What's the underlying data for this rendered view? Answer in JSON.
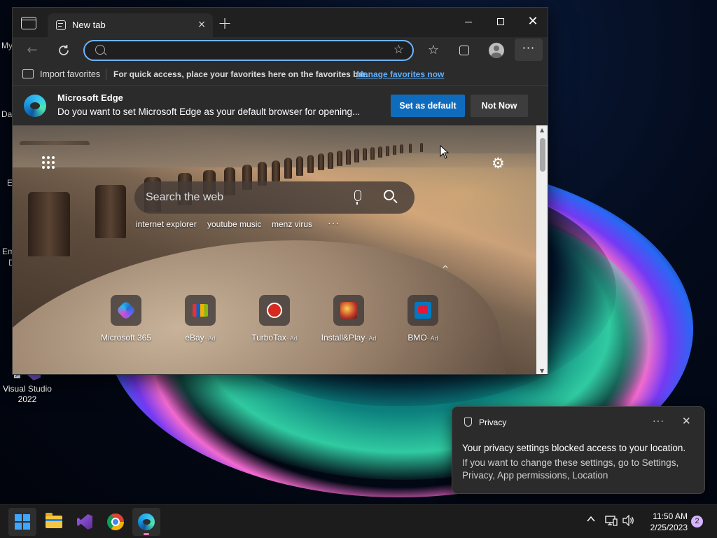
{
  "desktop": {
    "partial_labels": [
      "My",
      "Da",
      "E",
      "Em",
      "D"
    ],
    "visual_studio_label": "Visual Studio 2022"
  },
  "browser": {
    "tab_title": "New tab",
    "tab_close_icon": "×",
    "new_tab_icon": "+",
    "address_placeholder": "",
    "favorites_bar": {
      "import_label": "Import favorites",
      "message": "For quick access, place your favorites here on the favorites bar.",
      "link": "Manage favorites now"
    },
    "infobar": {
      "title": "Microsoft Edge",
      "message": "Do you want to set Microsoft Edge as your default browser for opening...",
      "primary_button": "Set as default",
      "secondary_button": "Not Now"
    },
    "newtab": {
      "search_placeholder": "Search the web",
      "suggestions": [
        "internet explorer",
        "youtube music",
        "menz virus"
      ],
      "more_icon": "···",
      "collapse_icon": "^",
      "quick_links": [
        {
          "label": "Microsoft 365",
          "ad": ""
        },
        {
          "label": "eBay",
          "ad": "· Ad"
        },
        {
          "label": "TurboTax",
          "ad": "· Ad"
        },
        {
          "label": "Install&Play",
          "ad": "· Ad"
        },
        {
          "label": "BMO",
          "ad": "· Ad"
        }
      ]
    }
  },
  "notification": {
    "app": "Privacy",
    "title": "Your privacy settings blocked access to your location.",
    "body": "If you want to change these settings, go to Settings, Privacy, App permissions, Location"
  },
  "taskbar": {
    "time": "11:50 AM",
    "date": "2/25/2023",
    "badge": "2"
  },
  "colors": {
    "accent": "#0f6cbd",
    "link": "#5fb0ff",
    "address_focus": "#6fb4ff"
  }
}
